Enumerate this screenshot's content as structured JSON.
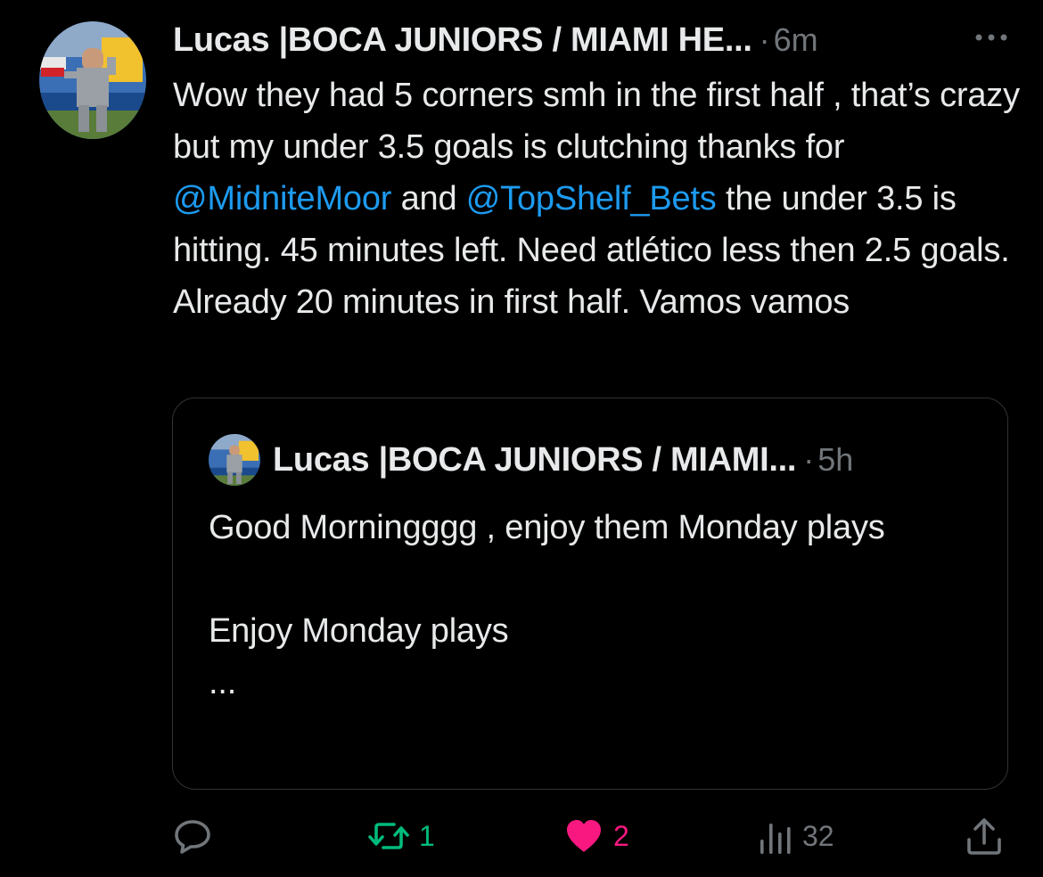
{
  "tweet": {
    "display_name": "Lucas |BOCA JUNIORS / MIAMI HE...",
    "separator": "·",
    "time": "6m",
    "text_segments": [
      {
        "text": "Wow they had 5 corners smh in the first half , that’s crazy but my under 3.5 goals is clutching thanks for ",
        "type": "text"
      },
      {
        "text": "@MidniteMoor",
        "type": "mention"
      },
      {
        "text": " and ",
        "type": "text"
      },
      {
        "text": "@TopShelf_Bets",
        "type": "mention"
      },
      {
        "text": " the under 3.5 is hitting. 45 minutes left. Need atlético less then 2.5 goals. Already 20 minutes in first half. Vamos vamos",
        "type": "text"
      }
    ],
    "avatar_icon": "profile-avatar-photo",
    "more_icon": "more-options-icon"
  },
  "quoted_tweet": {
    "display_name": "Lucas |BOCA JUNIORS / MIAMI...",
    "separator": "·",
    "time": "5h",
    "lines": [
      "Good Morningggg , enjoy them Monday plays",
      "",
      "Enjoy Monday plays",
      "..."
    ]
  },
  "actions": {
    "reply": {
      "icon": "reply-icon",
      "count": ""
    },
    "retweet": {
      "icon": "retweet-icon",
      "count": "1",
      "color": "#00ba7c"
    },
    "like": {
      "icon": "heart-icon",
      "count": "2",
      "color": "#f91880"
    },
    "views": {
      "icon": "views-icon",
      "count": "32"
    },
    "share": {
      "icon": "share-icon",
      "count": ""
    }
  },
  "colors": {
    "background": "#000000",
    "text": "#e7e9ea",
    "muted": "#71767b",
    "mention": "#1d9bf0",
    "border": "#2f3336"
  }
}
